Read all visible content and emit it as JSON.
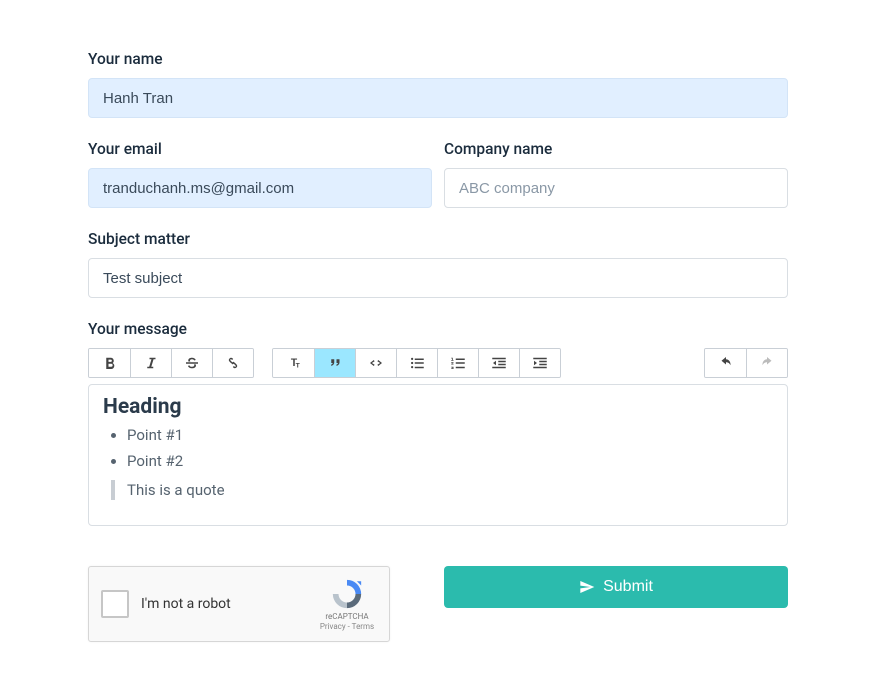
{
  "labels": {
    "name": "Your name",
    "email": "Your email",
    "company": "Company name",
    "subject": "Subject matter",
    "message": "Your message"
  },
  "values": {
    "name": "Hanh Tran",
    "email": "tranduchanh.ms@gmail.com",
    "subject": "Test subject"
  },
  "placeholders": {
    "company": "ABC company"
  },
  "editor_content": {
    "heading": "Heading",
    "points": [
      "Point #1",
      "Point #2"
    ],
    "quote": "This is a quote"
  },
  "captcha": {
    "label": "I'm not a robot",
    "brand": "reCAPTCHA",
    "links": "Privacy - Terms"
  },
  "submit": {
    "label": "Submit"
  }
}
